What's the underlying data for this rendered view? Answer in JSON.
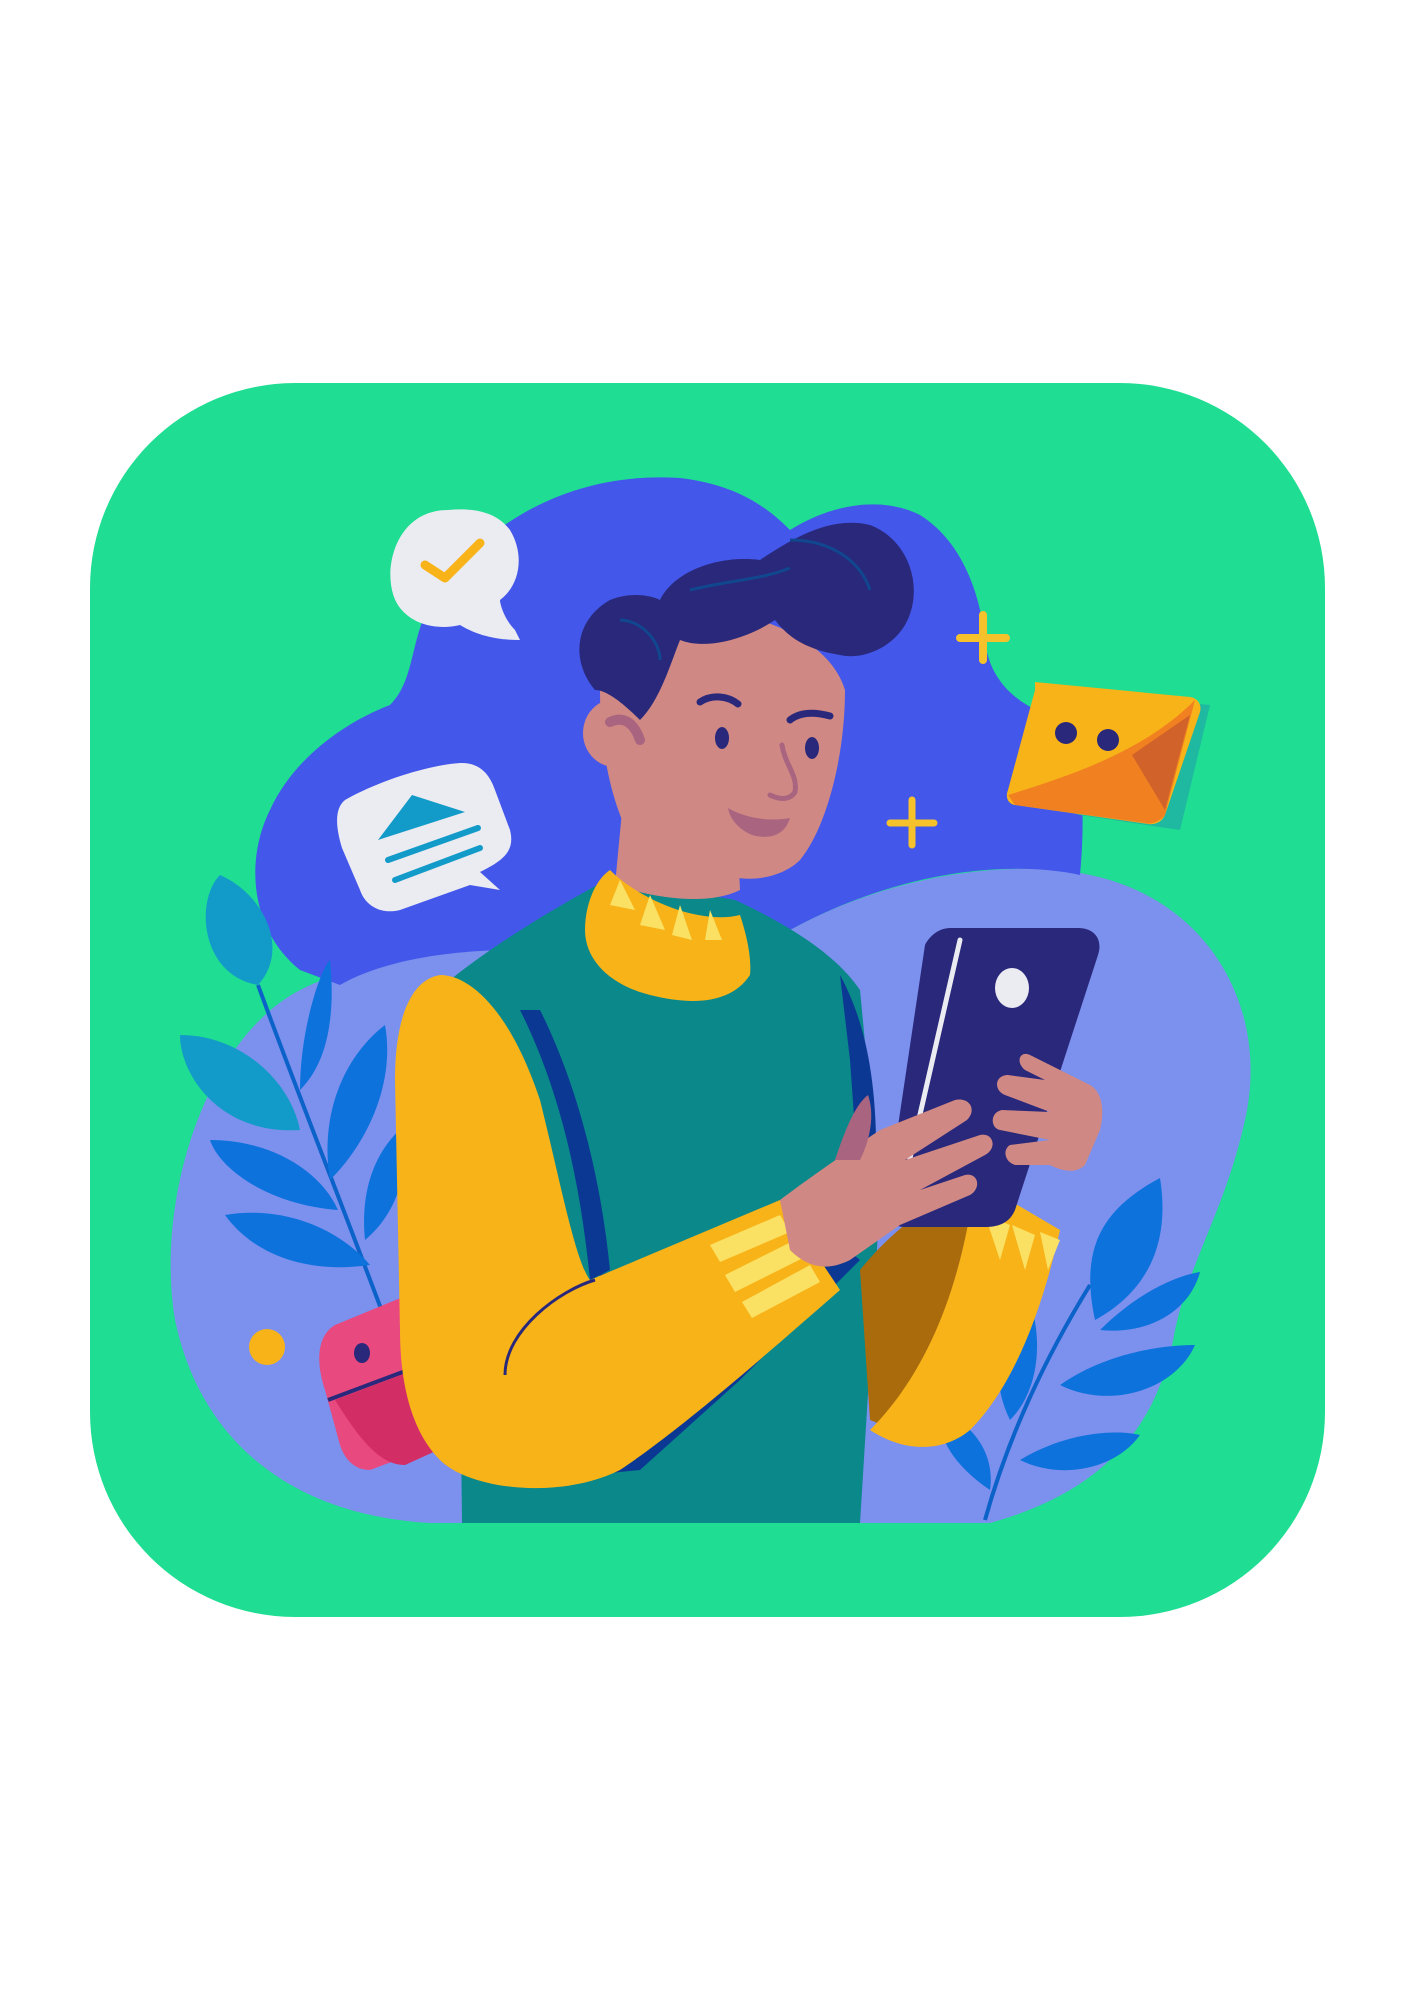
{
  "colors": {
    "page_background": "#ffffff",
    "card_green": "#1fdd92",
    "blob_blue": "#4357ea",
    "blob_periwinkle": "#7c90ee",
    "hair_navy": "#29287a",
    "skin": "#d08884",
    "skin_shadow": "#a9657f",
    "sweater_yellow": "#f8b319",
    "sweater_stripe": "#fbe163",
    "vest_teal": "#0a888a",
    "vest_dark": "#0b3893",
    "phone_navy": "#29287a",
    "bubble_white": "#ebebf2",
    "accent_orange": "#f08020",
    "accent_pink": "#e8497e",
    "leaf_blue": "#0d72dc",
    "leaf_cyan": "#129bc8",
    "sparkle_yellow": "#f6c22b"
  },
  "icons": [
    "checkmark-speech-bubble-icon",
    "email-speech-bubble-icon",
    "envelope-icon",
    "wallet-icon",
    "smartphone-icon",
    "sparkle-plus-icon",
    "leaf-branch-icon"
  ]
}
